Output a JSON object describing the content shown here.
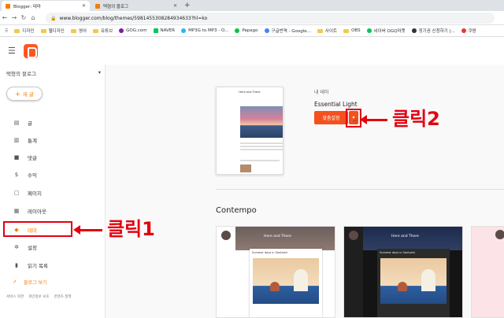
{
  "browser": {
    "tabs": [
      {
        "title": "Blogger: 테마",
        "active": true
      },
      {
        "title": "택형의 블로그",
        "active": false
      }
    ],
    "url": "www.blogger.com/blog/themes/5981455308284934633?hl=ko",
    "bookmarks": [
      "디자인",
      "웹디자인",
      "영어",
      "유튜브",
      "GOG.com",
      "NAVER",
      "MP3G to MP3 - O...",
      "Papago",
      "구글번역 - Google...",
      "사이트",
      "OBS",
      "네이버 OGQ마켓",
      "정기권 신청하기 |...",
      "쿠팡"
    ]
  },
  "app": {
    "brand_color": "#ff5722",
    "accent": "#f57d00"
  },
  "sidebar": {
    "blog_name": "택형의 블로그",
    "new_post_label": "새 글",
    "items": [
      {
        "label": "글",
        "icon": "posts-icon",
        "glyph": "▤"
      },
      {
        "label": "통계",
        "icon": "stats-icon",
        "glyph": "▥"
      },
      {
        "label": "댓글",
        "icon": "comments-icon",
        "glyph": "■"
      },
      {
        "label": "수익",
        "icon": "earnings-icon",
        "glyph": "$"
      },
      {
        "label": "페이지",
        "icon": "pages-icon",
        "glyph": "▢"
      },
      {
        "label": "레이아웃",
        "icon": "layout-icon",
        "glyph": "▦"
      },
      {
        "label": "테마",
        "icon": "theme-icon",
        "glyph": "◆",
        "active": true
      },
      {
        "label": "설정",
        "icon": "settings-icon",
        "glyph": "✲"
      },
      {
        "label": "읽기 목록",
        "icon": "reading-list-icon",
        "glyph": "▮"
      }
    ],
    "view_blog": "블로그 보기",
    "footer": [
      "서비스 약관",
      "개인정보 보호",
      "콘텐츠 정책"
    ]
  },
  "main": {
    "my_theme_label": "내 테마",
    "my_theme_name": "Essential Light",
    "customize_label": "맞춤설정",
    "dropdown_label": "▾",
    "thumb_title": "Here and There",
    "section_title": "Contempo",
    "cards": [
      {
        "title": "Here and There",
        "post": "Summer days in Santorini",
        "dark": false
      },
      {
        "title": "Here and There",
        "post": "Summer days in Santorini",
        "dark": true
      },
      {
        "title": "",
        "post": "",
        "dark": false
      }
    ]
  },
  "annotations": {
    "click1": "클릭1",
    "click2": "클릭2"
  }
}
